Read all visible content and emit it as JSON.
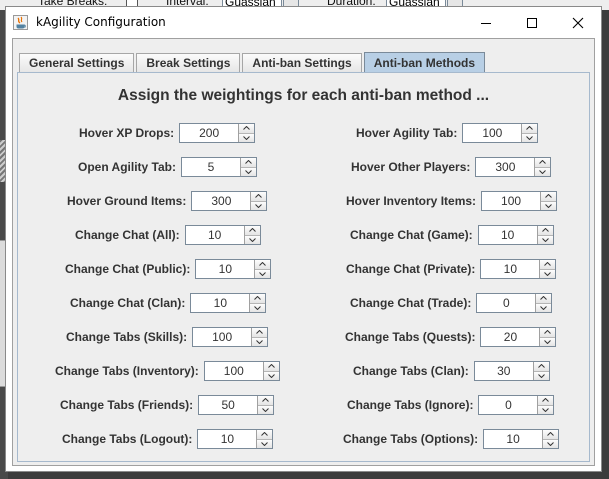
{
  "background": {
    "take_breaks_label": "Take Breaks:",
    "interval_label": "Interval:",
    "interval_value": "Guassian",
    "duration_label": "Duration:",
    "duration_value": "Guassian"
  },
  "window": {
    "title": "kAgility Configuration",
    "minimize_icon": "minimize-icon",
    "maximize_icon": "maximize-icon",
    "close_icon": "close-icon"
  },
  "tabs": [
    {
      "label": "General Settings",
      "active": false
    },
    {
      "label": "Break Settings",
      "active": false
    },
    {
      "label": "Anti-ban Settings",
      "active": false
    },
    {
      "label": "Anti-ban Methods",
      "active": true
    }
  ],
  "panel": {
    "heading": "Assign the weightings for each anti-ban method ...",
    "left": [
      {
        "label": "Hover XP Drops:",
        "value": "200"
      },
      {
        "label": "Open Agility Tab:",
        "value": "5"
      },
      {
        "label": "Hover Ground Items:",
        "value": "300"
      },
      {
        "label": "Change Chat (All):",
        "value": "10"
      },
      {
        "label": "Change Chat (Public):",
        "value": "10"
      },
      {
        "label": "Change Chat (Clan):",
        "value": "10"
      },
      {
        "label": "Change Tabs (Skills):",
        "value": "100"
      },
      {
        "label": "Change Tabs (Inventory):",
        "value": "100"
      },
      {
        "label": "Change Tabs (Friends):",
        "value": "50"
      },
      {
        "label": "Change Tabs (Logout):",
        "value": "10"
      }
    ],
    "right": [
      {
        "label": "Hover Agility Tab:",
        "value": "100"
      },
      {
        "label": "Hover Other Players:",
        "value": "300"
      },
      {
        "label": "Hover Inventory Items:",
        "value": "100"
      },
      {
        "label": "Change Chat (Game):",
        "value": "10"
      },
      {
        "label": "Change Chat (Private):",
        "value": "10"
      },
      {
        "label": "Change Chat (Trade):",
        "value": "0"
      },
      {
        "label": "Change Tabs (Quests):",
        "value": "20"
      },
      {
        "label": "Change Tabs (Clan):",
        "value": "30"
      },
      {
        "label": "Change Tabs (Ignore):",
        "value": "0"
      },
      {
        "label": "Change Tabs (Options):",
        "value": "10"
      }
    ]
  }
}
